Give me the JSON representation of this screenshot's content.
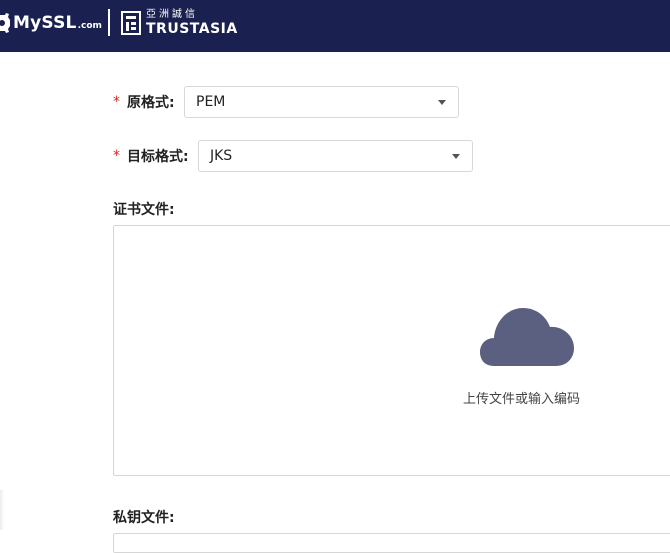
{
  "header": {
    "brand_primary": "MySSL",
    "brand_suffix": ".com",
    "partner_cn": "亞洲誠信",
    "partner_en": "TRUSTASIA"
  },
  "form": {
    "required_mark": "*",
    "source_format": {
      "label": "原格式:",
      "value": "PEM"
    },
    "target_format": {
      "label": "目标格式:",
      "value": "JKS"
    },
    "certificate_file": {
      "label": "证书文件:",
      "upload_hint": "上传文件或输入编码"
    },
    "private_key_file": {
      "label": "私钥文件:"
    }
  },
  "colors": {
    "header_bg": "#1a2150",
    "required": "#e02020",
    "cloud": "#5b5f80"
  }
}
